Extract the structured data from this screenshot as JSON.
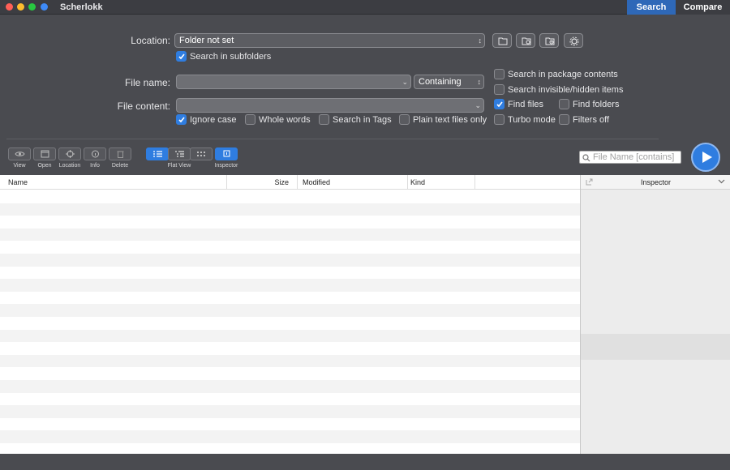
{
  "window": {
    "title": "Scherlokk",
    "traffic_lights": [
      "#ff5f57",
      "#febc2e",
      "#28c840",
      "#3e8af7"
    ]
  },
  "mode_tabs": [
    {
      "label": "Search",
      "active": true
    },
    {
      "label": "Compare",
      "active": false
    }
  ],
  "location": {
    "label": "Location:",
    "value": "Folder not set",
    "subfolders": {
      "label": "Search in subfolders",
      "checked": true
    }
  },
  "location_buttons": [
    "folder-icon",
    "folder-gear-icon",
    "folder-clock-icon",
    "gear-icon"
  ],
  "file_name": {
    "label": "File name:",
    "value": "",
    "match_mode": "Containing"
  },
  "file_content": {
    "label": "File content:",
    "value": ""
  },
  "content_options": [
    {
      "label": "Ignore case",
      "checked": true
    },
    {
      "label": "Whole words",
      "checked": false
    },
    {
      "label": "Search in Tags",
      "checked": false
    },
    {
      "label": "Plain text files only",
      "checked": false
    }
  ],
  "side_options": {
    "package_contents": {
      "label": "Search in package contents",
      "checked": false
    },
    "hidden_items": {
      "label": "Search invisible/hidden items",
      "checked": false
    },
    "find_files": {
      "label": "Find files",
      "checked": true
    },
    "find_folders": {
      "label": "Find folders",
      "checked": false
    },
    "turbo_mode": {
      "label": "Turbo mode",
      "checked": false
    },
    "filters_off": {
      "label": "Filters off",
      "checked": false
    }
  },
  "toolbar": {
    "view": "View",
    "open": "Open",
    "location": "Location",
    "info": "Info",
    "delete": "Delete",
    "view_mode_label": "Flat View",
    "inspector": "Inspector"
  },
  "filter": {
    "placeholder": "File Name [contains]"
  },
  "table": {
    "columns": [
      "Name",
      "Size",
      "Modified",
      "Kind"
    ],
    "rows": []
  },
  "inspector_panel": {
    "title": "Inspector"
  },
  "colors": {
    "accent": "#2f7de0",
    "background": "#4a4b50"
  }
}
